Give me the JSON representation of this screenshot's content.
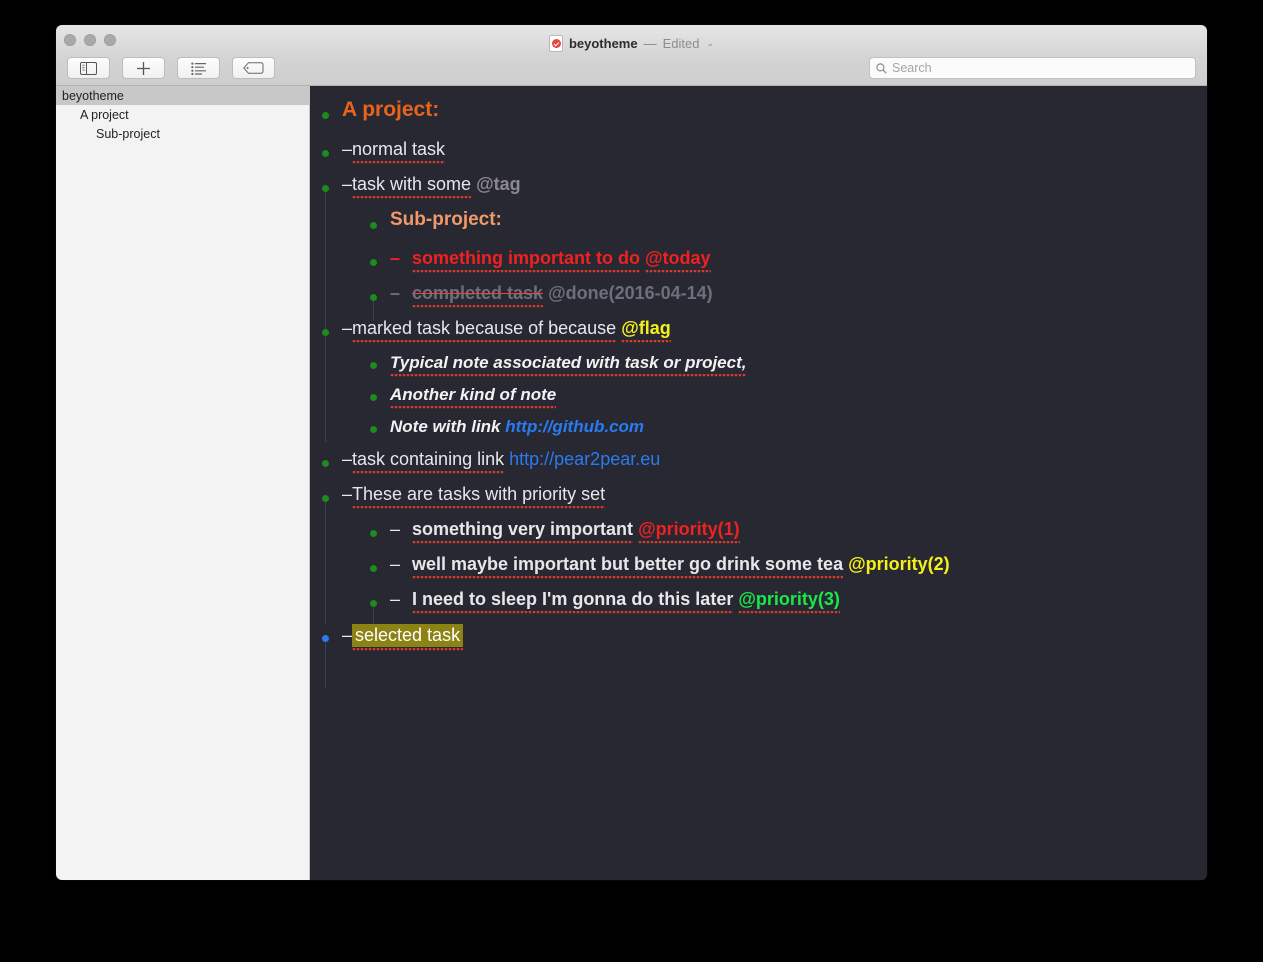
{
  "window": {
    "title_name": "beyotheme",
    "title_separator": "—",
    "title_edited": "Edited",
    "title_chevron": "⌄",
    "doc_icon": "taskpaper-document-icon"
  },
  "toolbar": {
    "buttons": [
      {
        "name": "toggle-sidebar-button",
        "icon": "sidebar-icon"
      },
      {
        "name": "new-item-button",
        "icon": "plus-icon"
      },
      {
        "name": "outline-list-button",
        "icon": "list-icon"
      },
      {
        "name": "tag-button",
        "icon": "tag-icon"
      }
    ],
    "search": {
      "placeholder": "Search",
      "value": "",
      "icon": "search-icon"
    }
  },
  "sidebar": {
    "items": [
      {
        "label": "beyotheme",
        "level": 0,
        "selected": true
      },
      {
        "label": "A project",
        "level": 1,
        "selected": false
      },
      {
        "label": "Sub-project",
        "level": 2,
        "selected": false
      }
    ]
  },
  "editor": {
    "theme_colors": {
      "background": "#272831",
      "text": "#e7e7ea",
      "project": "#e8641c",
      "subproject": "#f0996a",
      "tag_gray": "#8a8a8e",
      "tag_red": "#f02121",
      "tag_yellow": "#f5f018",
      "tag_green": "#1ae84a",
      "link": "#2a7bf0",
      "bullet_green": "#1d8b20",
      "bullet_blue": "#2a7bf0",
      "selection": "#8d8314",
      "strike": "#f0413c",
      "spell_underline": "#d93b2b",
      "guide_line": "#3b4250"
    },
    "lines": {
      "project": "A project:",
      "normal_task": "normal task",
      "task_with_tag": "task with some",
      "tag_tag": "@tag",
      "subproject": "Sub-project:",
      "important_task": "something important to do",
      "tag_today": "@today",
      "completed_task": "completed task",
      "tag_done": "@done(2016-04-14)",
      "marked_task": "marked task because of because",
      "tag_flag": "@flag",
      "note_1": "Typical note associated with task or project,",
      "note_2": "Another kind of note",
      "note_3_prefix": "Note with link",
      "note_3_link": "http://github.com",
      "task_link_prefix": "task containing link",
      "task_link": "http://pear2pear.eu",
      "priority_header": "These are tasks with priority set",
      "priority_1_text": "something very important",
      "tag_priority_1": "@priority(1)",
      "priority_2_text": "well maybe important but better go drink some tea",
      "tag_priority_2": "@priority(2)",
      "priority_3_text": "I need to sleep I'm gonna do this later",
      "tag_priority_3": "@priority(3)",
      "selected_task": "selected task"
    }
  }
}
